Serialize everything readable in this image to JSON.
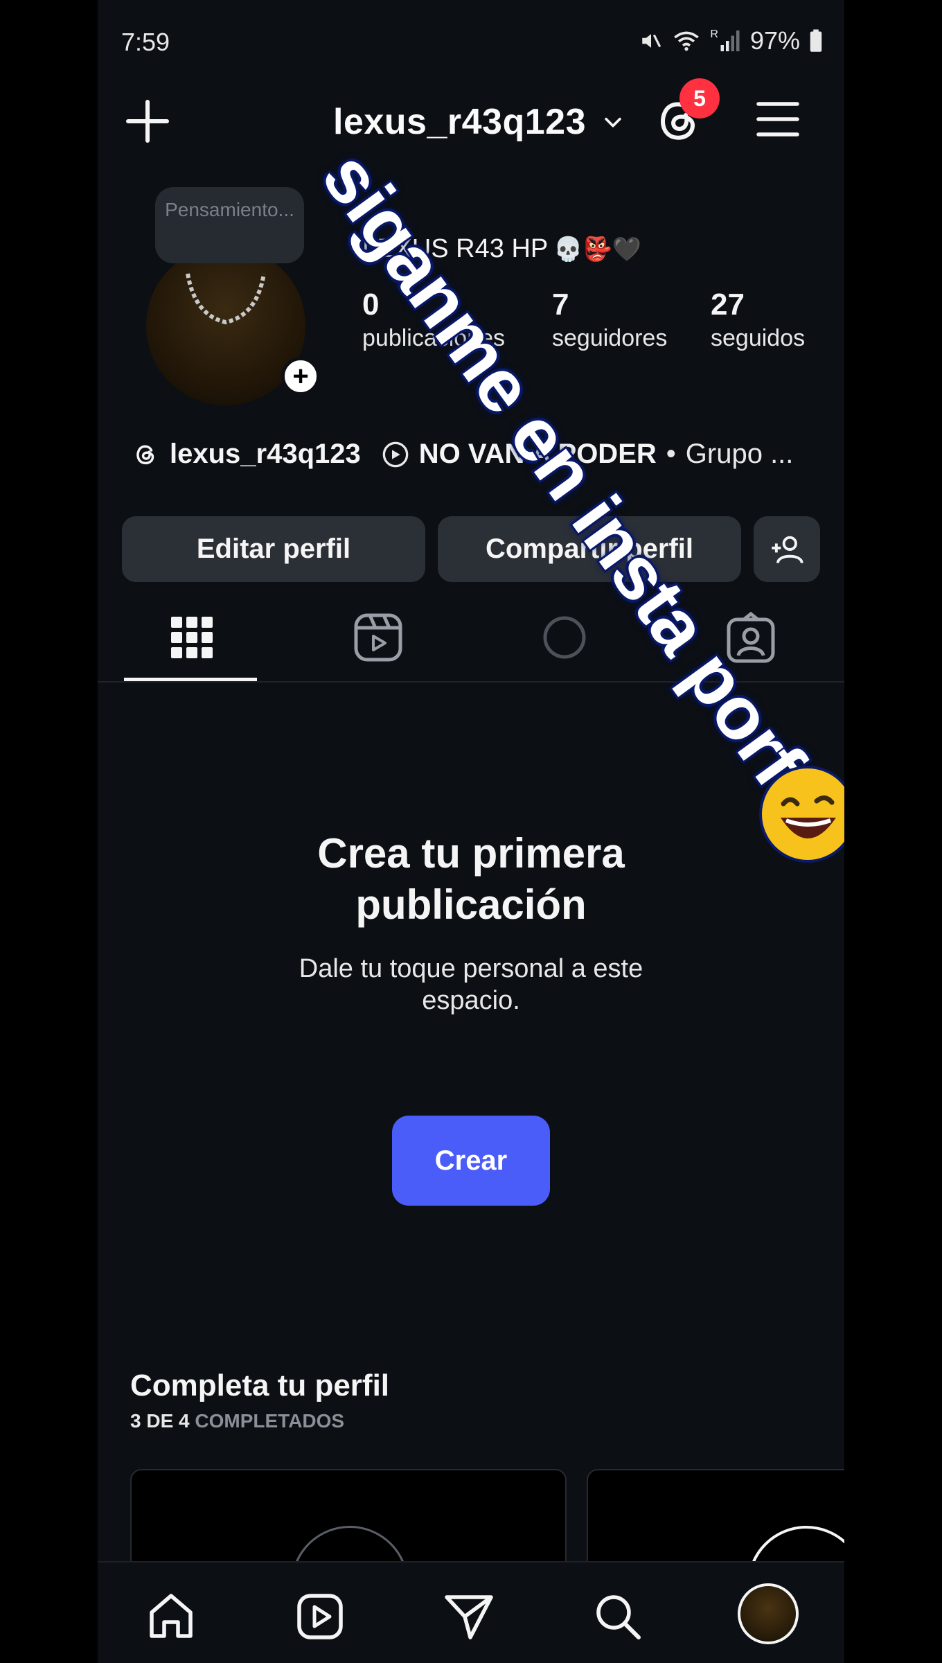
{
  "status_bar": {
    "time": "7:59",
    "battery": "97%",
    "indicator_r": "R"
  },
  "header": {
    "username": "lexus_r43q123",
    "notification_count": "5"
  },
  "profile": {
    "note_text": "Pensamiento...",
    "display_name": "LEXUS R43 HP",
    "display_emojis": "💀👺🖤",
    "stats": [
      {
        "value": "0",
        "label": "publicaciones"
      },
      {
        "value": "7",
        "label": "seguidores"
      },
      {
        "value": "27",
        "label": "seguidos"
      }
    ],
    "threads_handle": "lexus_r43q123",
    "channel_name": "NO VAN A PODER",
    "channel_separator": "•",
    "channel_type": "Grupo ..."
  },
  "actions": {
    "edit": "Editar perfil",
    "share": "Compartir perfil"
  },
  "empty_state": {
    "title_line1": "Crea tu primera",
    "title_line2": "publicación",
    "subtitle_line1": "Dale tu toque personal a este",
    "subtitle_line2": "espacio.",
    "create_label": "Crear"
  },
  "complete_profile": {
    "title": "Completa tu perfil",
    "progress_bold": "3 DE 4",
    "progress_dim": "COMPLETADOS"
  },
  "overlay": {
    "caption": "siganme en insta porfa"
  },
  "colors": {
    "background": "#0c0f14",
    "accent_blue": "#4a5df9",
    "badge_red": "#ff3040",
    "button_gray": "#2b2f36"
  }
}
